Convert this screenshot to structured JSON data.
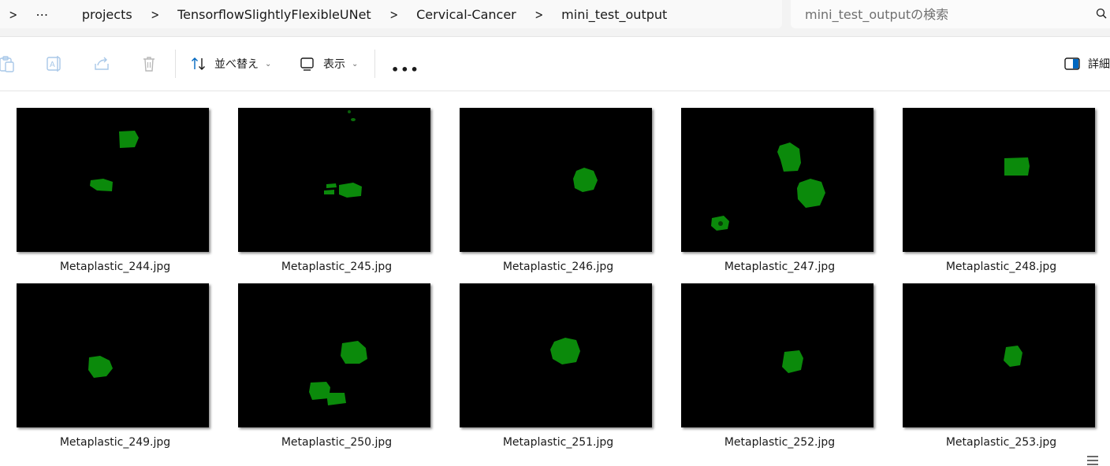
{
  "breadcrumb": {
    "more": "⋯",
    "items": [
      "projects",
      "TensorflowSlightlyFlexibleUNet",
      "Cervical-Cancer",
      "mini_test_output"
    ]
  },
  "search": {
    "placeholder": "mini_test_outputの検索"
  },
  "toolbar": {
    "sort_label": "並べ替え",
    "view_label": "表示",
    "more": "•••",
    "details_label": "詳細"
  },
  "files": [
    {
      "name": "Metaplastic_244.jpg"
    },
    {
      "name": "Metaplastic_245.jpg"
    },
    {
      "name": "Metaplastic_246.jpg"
    },
    {
      "name": "Metaplastic_247.jpg"
    },
    {
      "name": "Metaplastic_248.jpg"
    },
    {
      "name": "Metaplastic_249.jpg"
    },
    {
      "name": "Metaplastic_250.jpg"
    },
    {
      "name": "Metaplastic_251.jpg"
    },
    {
      "name": "Metaplastic_252.jpg"
    },
    {
      "name": "Metaplastic_253.jpg"
    }
  ],
  "colors": {
    "mask_green": "#0b8a0b",
    "accent": "#0067c0"
  }
}
